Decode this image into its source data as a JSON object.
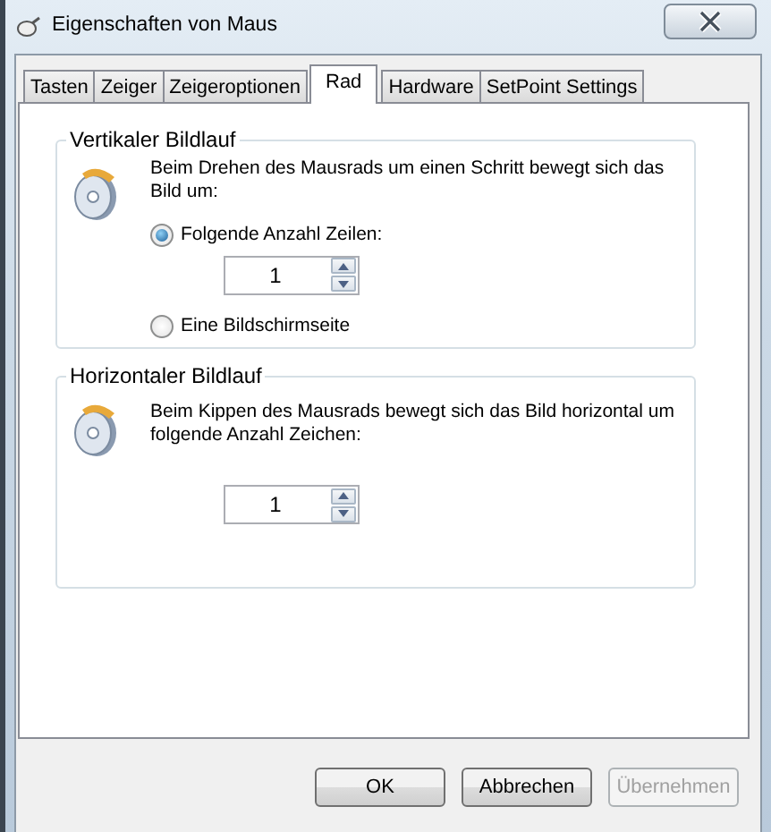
{
  "window": {
    "title": "Eigenschaften von Maus"
  },
  "tabs": [
    {
      "label": "Tasten",
      "selected": false
    },
    {
      "label": "Zeiger",
      "selected": false
    },
    {
      "label": "Zeigeroptionen",
      "selected": false
    },
    {
      "label": "Rad",
      "selected": true
    },
    {
      "label": "Hardware",
      "selected": false
    },
    {
      "label": "SetPoint Settings",
      "selected": false
    }
  ],
  "vertical_scrolling": {
    "legend": "Vertikaler Bildlauf",
    "description": "Beim Drehen des Mausrads um einen Schritt bewegt sich das Bild um:",
    "options": [
      {
        "label": "Folgende Anzahl Zeilen:",
        "selected": true,
        "spinner_value": "1"
      },
      {
        "label": "Eine Bildschirmseite",
        "selected": false
      }
    ]
  },
  "horizontal_scrolling": {
    "legend": "Horizontaler Bildlauf",
    "description": "Beim Kippen des Mausrads bewegt sich das Bild horizontal um folgende Anzahl Zeichen:",
    "spinner_value": "1"
  },
  "buttons": [
    {
      "label": "OK",
      "disabled": false
    },
    {
      "label": "Abbrechen",
      "disabled": false
    },
    {
      "label": "Übernehmen",
      "disabled": true
    }
  ]
}
